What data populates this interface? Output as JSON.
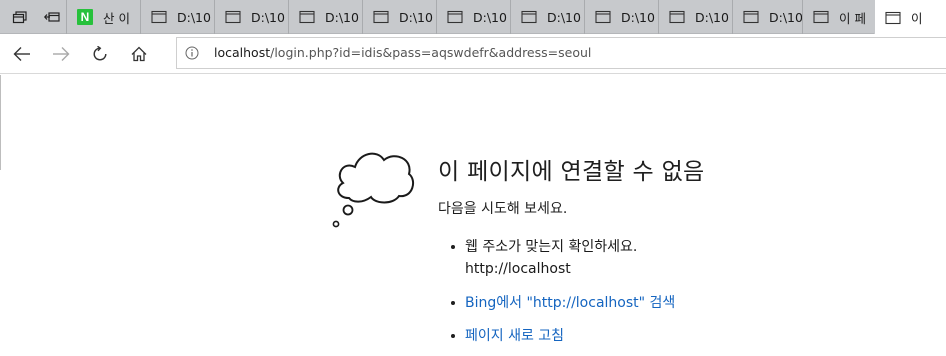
{
  "tabs": [
    {
      "label": "산 이",
      "icon": "naver-icon"
    },
    {
      "label": "D:\\10",
      "icon": "page-icon"
    },
    {
      "label": "D:\\10",
      "icon": "page-icon"
    },
    {
      "label": "D:\\10",
      "icon": "page-icon"
    },
    {
      "label": "D:\\10",
      "icon": "page-icon"
    },
    {
      "label": "D:\\10",
      "icon": "page-icon"
    },
    {
      "label": "D:\\10",
      "icon": "page-icon"
    },
    {
      "label": "D:\\10",
      "icon": "page-icon"
    },
    {
      "label": "D:\\10",
      "icon": "page-icon"
    },
    {
      "label": "D:\\10",
      "icon": "page-icon"
    },
    {
      "label": "이 페",
      "icon": "page-icon"
    },
    {
      "label": "이",
      "icon": "page-icon",
      "active": true
    }
  ],
  "naver_letter": "N",
  "address": {
    "host": "localhost",
    "path": "/login.php?id=idis&pass=aqswdefr&address=seoul"
  },
  "error": {
    "title": "이 페이지에 연결할 수 없음",
    "subtitle": "다음을 시도해 보세요.",
    "suggestion_check": "웹 주소가 맞는지 확인하세요.",
    "suggestion_host": "http://localhost",
    "suggestion_search": "Bing에서 \"http://localhost\" 검색",
    "suggestion_refresh": "페이지 새로 고침"
  },
  "colors": {
    "tabbar": "#c7c9cc",
    "link": "#1565c0",
    "naver_green": "#27c13c"
  }
}
